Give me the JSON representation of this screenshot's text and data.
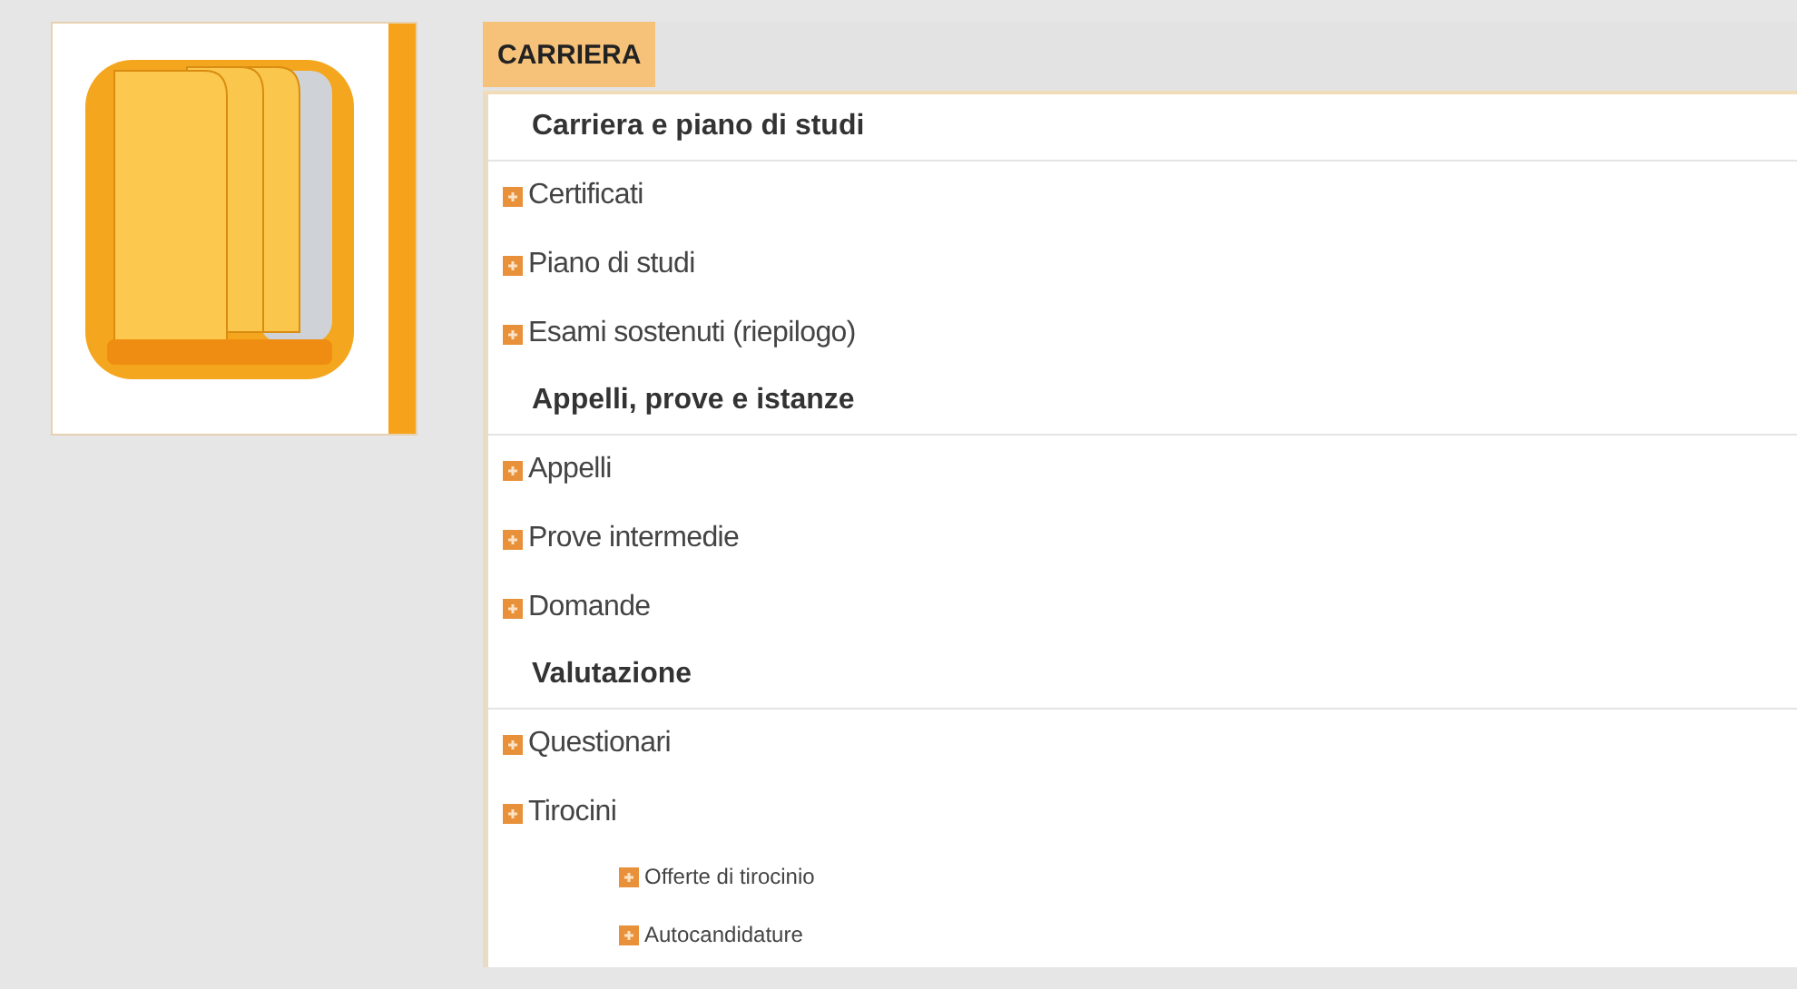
{
  "tab": {
    "label": "CARRIERA",
    "selected": true
  },
  "sections": [
    {
      "title": "Carriera e piano di studi",
      "items": [
        {
          "label": "Certificati"
        },
        {
          "label": "Piano di studi"
        },
        {
          "label": "Esami sostenuti (riepilogo)"
        }
      ]
    },
    {
      "title": "Appelli, prove e istanze",
      "items": [
        {
          "label": "Appelli"
        },
        {
          "label": "Prove intermedie"
        },
        {
          "label": "Domande"
        }
      ]
    },
    {
      "title": "Valutazione",
      "items": [
        {
          "label": "Questionari"
        },
        {
          "label": "Tirocini",
          "children": [
            {
              "label": "Offerte di tirocinio"
            },
            {
              "label": "Autocandidature"
            }
          ]
        }
      ]
    }
  ]
}
